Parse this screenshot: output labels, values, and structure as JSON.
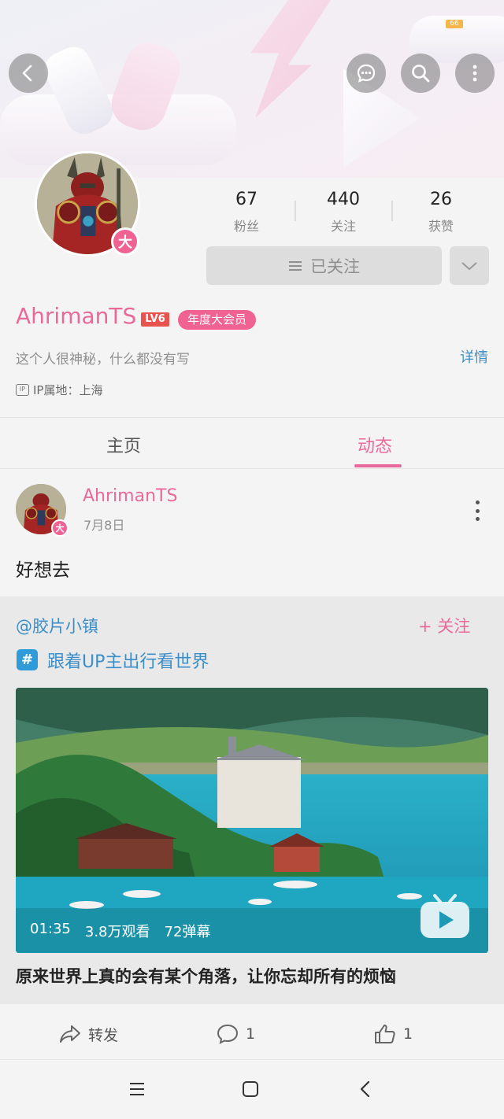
{
  "status_bar": {
    "battery": "66"
  },
  "profile": {
    "vip_badge_char": "大",
    "stats": [
      {
        "value": "67",
        "label": "粉丝"
      },
      {
        "value": "440",
        "label": "关注"
      },
      {
        "value": "26",
        "label": "获赞"
      }
    ],
    "follow_state": "已关注",
    "username": "AhrimanTS",
    "level": "LV6",
    "vip_label": "年度大会员",
    "bio": "这个人很神秘，什么都没有写",
    "detail_link": "详情",
    "ip_icon": "IP",
    "ip_location": "IP属地：上海"
  },
  "tabs": [
    {
      "label": "主页",
      "active": false
    },
    {
      "label": "动态",
      "active": true
    }
  ],
  "post": {
    "author": "AhrimanTS",
    "date": "7月8日",
    "text": "好想去",
    "shared": {
      "author": "@胶片小镇",
      "follow_label": "+ 关注",
      "topic_icon": "#",
      "topic": "跟着UP主出行看世界",
      "video": {
        "duration": "01:35",
        "views": "3.8万观看",
        "danmaku": "72弹幕",
        "title": "原来世界上真的会有某个角落，让你忘却所有的烦恼"
      }
    },
    "actions": {
      "forward_label": "转发",
      "comment_count": "1",
      "like_count": "1"
    }
  },
  "colors": {
    "accent_pink": "#e9699a",
    "link_blue": "#3c8ec9",
    "level_red": "#e8534d"
  }
}
